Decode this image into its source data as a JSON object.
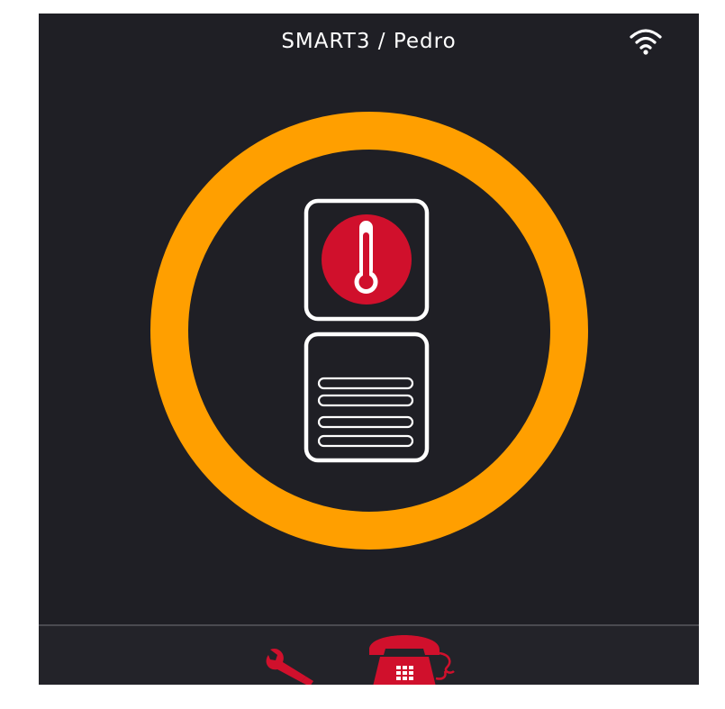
{
  "header": {
    "title": "SMART3 / Pedro",
    "connection_icon": "wifi-icon"
  },
  "status": {
    "ring_color": "#ff9f00",
    "sensor_icon": "thermometer-icon",
    "sensor_color": "#d0102c",
    "device_icon": "radiator-panel-icon"
  },
  "toolbar": {
    "settings_icon": "wrench-icon",
    "call_icon": "telephone-icon",
    "accent_color": "#d0102c"
  },
  "theme": {
    "background": "#1f1f25",
    "foreground": "#ffffff"
  }
}
